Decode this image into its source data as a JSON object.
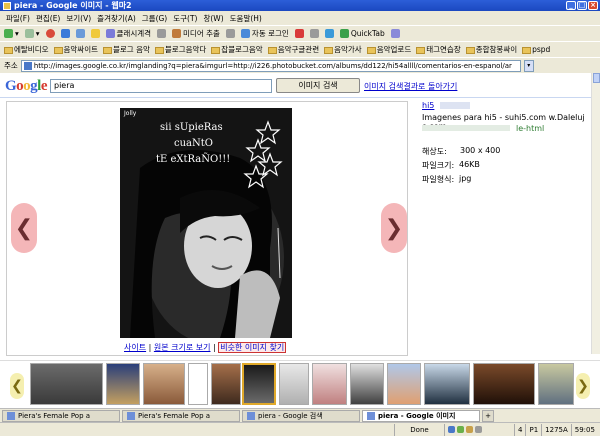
{
  "window": {
    "title": "piera - Google 이미지 - 웹마2"
  },
  "menu": [
    "파일(F)",
    "편집(E)",
    "보기(V)",
    "즐겨찾기(A)",
    "그룹(G)",
    "도구(T)",
    "창(W)",
    "도움말(H)"
  ],
  "toolbar": {
    "items": [
      "클래시계격",
      "미디어 추출",
      "자동 로그인",
      "QuickTab"
    ]
  },
  "bookmarks": [
    "에탈비디오",
    "음악싸이트",
    "블로그 음악",
    "블로그음악다",
    "잡블로그음악",
    "음악구글관련",
    "음악가사",
    "음악업로드",
    "태그연습장",
    "종합참봉싸이",
    "pspd"
  ],
  "address": {
    "label": "주소",
    "url": "http://images.google.co.kr/imglanding?q=piera&imgurl=http://i226.photobucket.com/albums/dd122/hi54allll/comentarios-en-espanol/ar"
  },
  "search": {
    "logo": "Google",
    "query": "piera",
    "button": "이미지 검색",
    "back_link": "이미지 검색결과로 돌아가기"
  },
  "image": {
    "caption_lines": [
      "sii sUpieRas",
      "cuaNtO",
      "tE eXtRaÑO!!!"
    ],
    "tag": "Jolly",
    "links": {
      "site": "사이트",
      "sep1": " | ",
      "full": "원본 크기로 보기",
      "sep2": " | ",
      "similar": "비슷한 이미지 찾기"
    }
  },
  "meta": {
    "site_link": "hi5",
    "desc": "Imagenes para hi5 - suhi5.com w.Daleluj o.com",
    "url": "le-html",
    "size_label": "해상도:",
    "size_value": "300 x 400",
    "filesize_label": "파일크기:",
    "filesize_value": "46KB",
    "format_label": "파일형식:",
    "format_value": "jpg"
  },
  "nav": {
    "prev": "❮",
    "next": "❯"
  },
  "filmstrip": {
    "prev": "❮",
    "next": "❯",
    "count": 13
  },
  "tabs": [
    {
      "label": "Piera's Female Pop a"
    },
    {
      "label": "Piera's Female Pop a"
    },
    {
      "label": "piera - Google 검색"
    },
    {
      "label": "piera - Google 이미지"
    }
  ],
  "status": {
    "done": "Done",
    "page": "4",
    "p": "P1",
    "code": "1275A",
    "time": "59:05"
  },
  "colors": {
    "title_blue": "#1b48c0",
    "chrome": "#ece9d8",
    "link": "#0000cc",
    "nav_arrow": "#f4b6b8",
    "film_arrow": "#f5efb0"
  }
}
